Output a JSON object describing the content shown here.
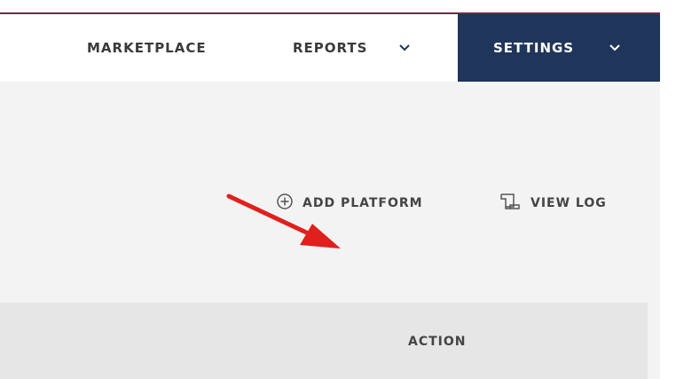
{
  "nav": {
    "marketplace": "MARKETPLACE",
    "reports": "REPORTS",
    "settings": "SETTINGS"
  },
  "toolbar": {
    "add_platform": "ADD PLATFORM",
    "view_log": "VIEW LOG"
  },
  "table": {
    "columns": [
      "ACTION"
    ]
  },
  "icons": {
    "reports_chevron": "chevron-down-icon",
    "settings_chevron": "chevron-down-icon",
    "add_platform": "plus-circle-icon",
    "view_log": "scroll-icon"
  },
  "colors": {
    "top_rule": "#6e2a45",
    "settings_bg": "#1f3559",
    "chevron": "#1f3559",
    "content_bg": "#f3f3f3",
    "table_header_bg": "#e6e6e6",
    "annotation_arrow": "#e0201c"
  }
}
